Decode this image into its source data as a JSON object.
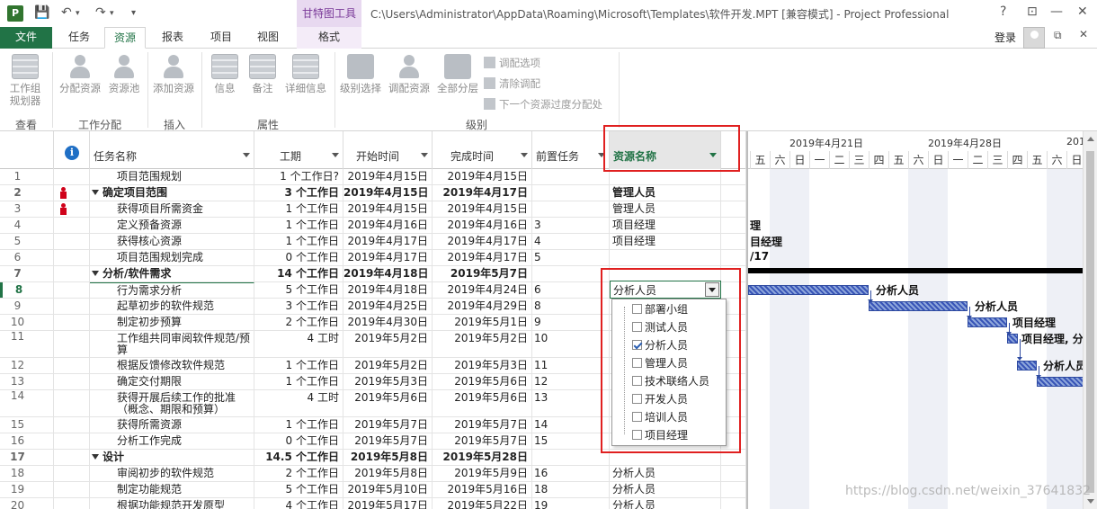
{
  "titlebar": {
    "app_icon": "P",
    "context_tools": "甘特图工具",
    "window_title": "C:\\Users\\Administrator\\AppData\\Roaming\\Microsoft\\Templates\\软件开发.MPT [兼容模式] - Project Professional",
    "help": "?",
    "minimize": "—",
    "restore": "□",
    "close": "✕"
  },
  "tabs": {
    "file": "文件",
    "task": "任务",
    "resource": "资源",
    "report": "报表",
    "project": "项目",
    "view": "视图",
    "format": "格式",
    "login": "登录"
  },
  "ribbon": {
    "team_planner": "工作组\n规划器",
    "assign": "分配资源",
    "pool": "资源池",
    "add": "添加资源",
    "info": "信息",
    "notes": "备注",
    "details": "详细信息",
    "level_sel": "级别选择",
    "level_res": "调配资源",
    "level_all": "全部分层",
    "level_opts": "调配选项",
    "clear_level": "清除调配",
    "next_over": "下一个资源过度分配处",
    "groups": {
      "view": "查看",
      "assignments": "工作分配",
      "insert": "插入",
      "properties": "属性",
      "level": "级别"
    }
  },
  "columns": {
    "name": "任务名称",
    "duration": "工期",
    "start": "开始时间",
    "finish": "完成时间",
    "pred": "前置任务",
    "resource": "资源名称"
  },
  "rows": [
    {
      "id": "1",
      "name": "项目范围规划",
      "dur": "1 个工作日?",
      "start": "2019年4月15日",
      "fin": "2019年4月15日",
      "pred": "",
      "res": ""
    },
    {
      "id": "2",
      "name": "确定项目范围",
      "dur": "3 个工作日",
      "start": "2019年4月15日",
      "fin": "2019年4月17日",
      "pred": "",
      "res": "管理人员"
    },
    {
      "id": "3",
      "name": "获得项目所需资金",
      "dur": "1 个工作日",
      "start": "2019年4月15日",
      "fin": "2019年4月15日",
      "pred": "",
      "res": "管理人员"
    },
    {
      "id": "4",
      "name": "定义预备资源",
      "dur": "1 个工作日",
      "start": "2019年4月16日",
      "fin": "2019年4月16日",
      "pred": "3",
      "res": "项目经理"
    },
    {
      "id": "5",
      "name": "获得核心资源",
      "dur": "1 个工作日",
      "start": "2019年4月17日",
      "fin": "2019年4月17日",
      "pred": "4",
      "res": "项目经理"
    },
    {
      "id": "6",
      "name": "项目范围规划完成",
      "dur": "0 个工作日",
      "start": "2019年4月17日",
      "fin": "2019年4月17日",
      "pred": "5",
      "res": ""
    },
    {
      "id": "7",
      "name": "分析/软件需求",
      "dur": "14 个工作日",
      "start": "2019年4月18日",
      "fin": "2019年5月7日",
      "pred": "",
      "res": ""
    },
    {
      "id": "8",
      "name": "行为需求分析",
      "dur": "5 个工作日",
      "start": "2019年4月18日",
      "fin": "2019年4月24日",
      "pred": "6",
      "res": ""
    },
    {
      "id": "9",
      "name": "起草初步的软件规范",
      "dur": "3 个工作日",
      "start": "2019年4月25日",
      "fin": "2019年4月29日",
      "pred": "8",
      "res": ""
    },
    {
      "id": "10",
      "name": "制定初步预算",
      "dur": "2 个工作日",
      "start": "2019年4月30日",
      "fin": "2019年5月1日",
      "pred": "9",
      "res": ""
    },
    {
      "id": "11",
      "name": "工作组共同审阅软件规范/预算",
      "dur": "4 工时",
      "start": "2019年5月2日",
      "fin": "2019年5月2日",
      "pred": "10",
      "res": ""
    },
    {
      "id": "12",
      "name": "根据反馈修改软件规范",
      "dur": "1 个工作日",
      "start": "2019年5月2日",
      "fin": "2019年5月3日",
      "pred": "11",
      "res": ""
    },
    {
      "id": "13",
      "name": "确定交付期限",
      "dur": "1 个工作日",
      "start": "2019年5月3日",
      "fin": "2019年5月6日",
      "pred": "12",
      "res": ""
    },
    {
      "id": "14",
      "name": "获得开展后续工作的批准（概念、期限和预算）",
      "dur": "4 工时",
      "start": "2019年5月6日",
      "fin": "2019年5月6日",
      "pred": "13",
      "res": ""
    },
    {
      "id": "15",
      "name": "获得所需资源",
      "dur": "1 个工作日",
      "start": "2019年5月7日",
      "fin": "2019年5月7日",
      "pred": "14",
      "res": ""
    },
    {
      "id": "16",
      "name": "分析工作完成",
      "dur": "0 个工作日",
      "start": "2019年5月7日",
      "fin": "2019年5月7日",
      "pred": "15",
      "res": ""
    },
    {
      "id": "17",
      "name": "设计",
      "dur": "14.5 个工作日",
      "start": "2019年5月8日",
      "fin": "2019年5月28日",
      "pred": "",
      "res": ""
    },
    {
      "id": "18",
      "name": "审阅初步的软件规范",
      "dur": "2 个工作日",
      "start": "2019年5月8日",
      "fin": "2019年5月9日",
      "pred": "16",
      "res": "分析人员"
    },
    {
      "id": "19",
      "name": "制定功能规范",
      "dur": "5 个工作日",
      "start": "2019年5月10日",
      "fin": "2019年5月16日",
      "pred": "18",
      "res": "分析人员"
    },
    {
      "id": "20",
      "name": "根据功能规范开发原型",
      "dur": "4 个工作日",
      "start": "2019年5月17日",
      "fin": "2019年5月22日",
      "pred": "19",
      "res": "分析人员"
    }
  ],
  "editor": {
    "value": "分析人员",
    "options": [
      {
        "label": "部署小组",
        "checked": false
      },
      {
        "label": "测试人员",
        "checked": false
      },
      {
        "label": "分析人员",
        "checked": true
      },
      {
        "label": "管理人员",
        "checked": false
      },
      {
        "label": "技术联络人员",
        "checked": false
      },
      {
        "label": "开发人员",
        "checked": false
      },
      {
        "label": "培训人员",
        "checked": false
      },
      {
        "label": "项目经理",
        "checked": false
      }
    ]
  },
  "gantt": {
    "week1": "2019年4月21日",
    "week2": "2019年4月28日",
    "week3": "201",
    "days": [
      "五",
      "六",
      "日",
      "一",
      "二",
      "三",
      "四",
      "五",
      "六",
      "日",
      "一",
      "二",
      "三",
      "四",
      "五",
      "六",
      "日"
    ],
    "labels": {
      "r4": "理",
      "r5": "目经理",
      "r6": "/17",
      "r8": "分析人员",
      "r9": "分析人员",
      "r10": "项目经理",
      "r11": "项目经理, 分",
      "r12": "分析人员"
    }
  },
  "watermark": "https://blog.csdn.net/weixin_37641832"
}
